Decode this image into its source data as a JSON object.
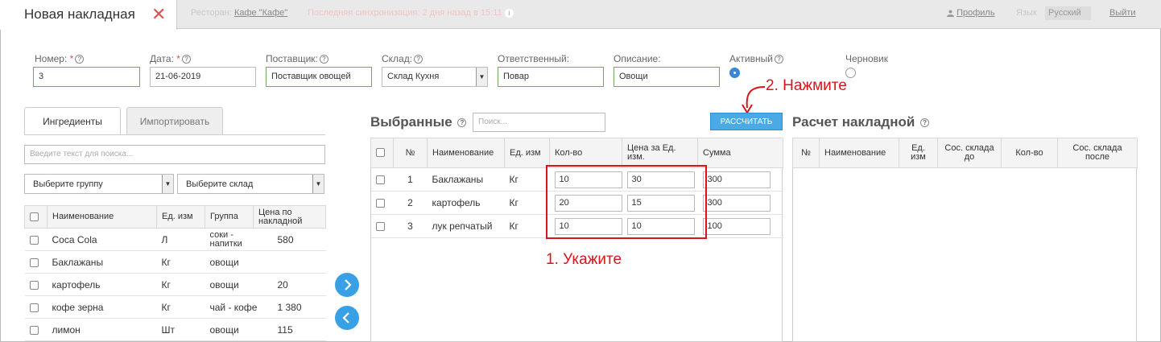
{
  "header": {
    "title": "Новая накладная",
    "close_glyph": "✕",
    "restaurant_label": "Ресторан:",
    "restaurant_name": "Кафе \"Кафе\"",
    "sync_text": "Последняя синхронизация: 2 дня назад в 15:11",
    "profile_label": "Профиль",
    "language_label": "Язык",
    "language_value": "Русский",
    "logout_label": "Выйти"
  },
  "form": {
    "number": {
      "label": "Номер:",
      "req": "*",
      "value": "3"
    },
    "date": {
      "label": "Дата:",
      "req": "*",
      "value": "21-06-2019"
    },
    "supplier": {
      "label": "Поставщик:",
      "value": "Поставщик овощей"
    },
    "warehouse": {
      "label": "Склад:",
      "value": "Склад Кухня"
    },
    "responsible": {
      "label": "Ответственный:",
      "value": "Повар"
    },
    "description": {
      "label": "Описание:",
      "value": "Овощи"
    },
    "active": {
      "label": "Активный",
      "checked": true
    },
    "draft": {
      "label": "Черновик",
      "checked": false
    }
  },
  "left_panel": {
    "tabs": [
      "Ингредиенты",
      "Импортировать"
    ],
    "search_placeholder": "Введите текст для поиска...",
    "group_select": "Выберите группу",
    "warehouse_select": "Выберите склад",
    "columns": [
      "Наименование",
      "Ед. изм",
      "Группа",
      "Цена по накладной"
    ],
    "rows": [
      {
        "name": "Coca Cola",
        "unit": "Л",
        "group": "соки - напитки",
        "price": "580"
      },
      {
        "name": "Баклажаны",
        "unit": "Кг",
        "group": "овощи",
        "price": ""
      },
      {
        "name": "картофель",
        "unit": "Кг",
        "group": "овощи",
        "price": "20"
      },
      {
        "name": "кофе зерна",
        "unit": "Кг",
        "group": "чай - кофе",
        "price": "1 380"
      },
      {
        "name": "лимон",
        "unit": "Шт",
        "group": "овощи",
        "price": "115"
      }
    ]
  },
  "selected_panel": {
    "title": "Выбранные",
    "search_placeholder": "Поиск...",
    "calc_button": "РАССЧИТАТЬ",
    "columns": [
      "№",
      "Наименование",
      "Ед. изм",
      "Кол-во",
      "Цена за Ед. изм.",
      "Сумма"
    ],
    "rows": [
      {
        "num": "1",
        "name": "Баклажаны",
        "unit": "Кг",
        "qty": "10",
        "price": "30",
        "sum": "300"
      },
      {
        "num": "2",
        "name": "картофель",
        "unit": "Кг",
        "qty": "20",
        "price": "15",
        "sum": "300"
      },
      {
        "num": "3",
        "name": "лук репчатый",
        "unit": "Кг",
        "qty": "10",
        "price": "10",
        "sum": "100"
      }
    ]
  },
  "calc_panel": {
    "title": "Расчет накладной",
    "columns": [
      "№",
      "Наименование",
      "Ед. изм",
      "Сос. склада до",
      "Кол-во",
      "Сос. склада после"
    ]
  },
  "annotations": {
    "step1": "1. Укажите",
    "step2": "2. Нажмите"
  },
  "colors": {
    "accent": "#3aa0e6",
    "annotation": "#d9141a",
    "field_border_green": "#74a860"
  },
  "icons": {
    "add_to_selected": "chevron-right-icon",
    "remove_from_selected": "chevron-left-icon",
    "profile": "user-icon",
    "help": "question-icon"
  }
}
